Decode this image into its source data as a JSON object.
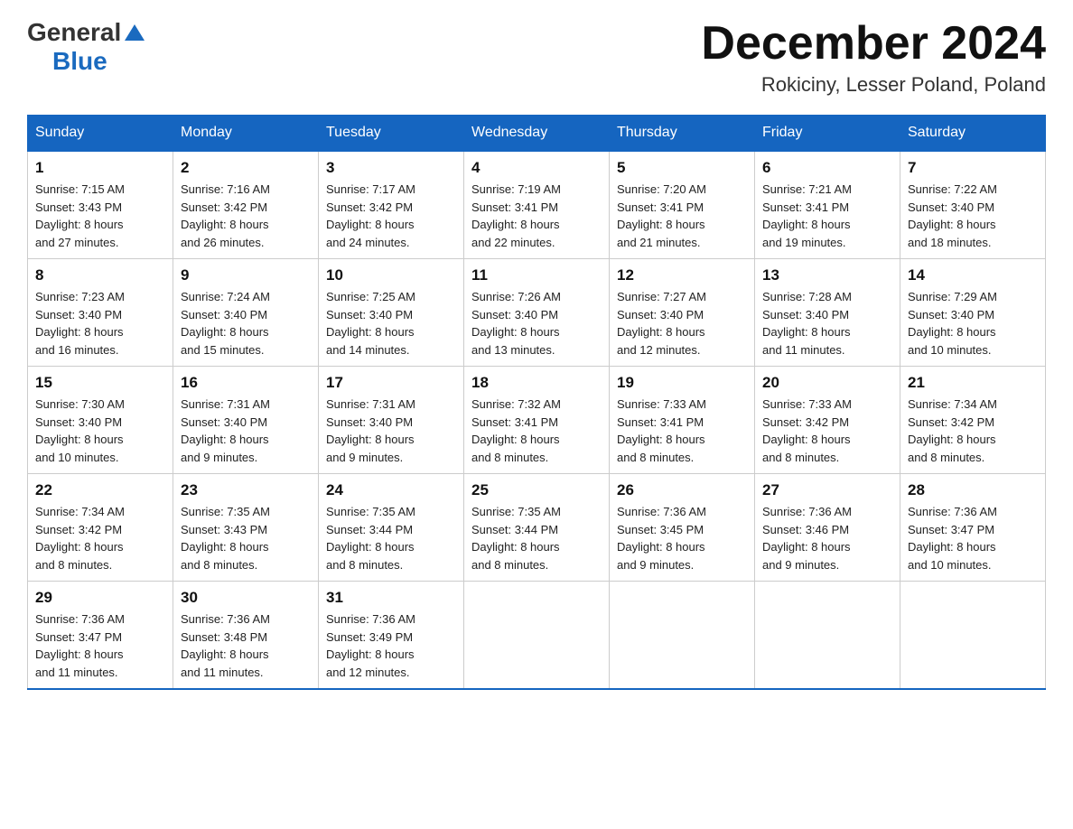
{
  "header": {
    "month_title": "December 2024",
    "location": "Rokiciny, Lesser Poland, Poland",
    "logo_general": "General",
    "logo_blue": "Blue"
  },
  "days_of_week": [
    "Sunday",
    "Monday",
    "Tuesday",
    "Wednesday",
    "Thursday",
    "Friday",
    "Saturday"
  ],
  "weeks": [
    [
      {
        "day": "1",
        "sunrise": "7:15 AM",
        "sunset": "3:43 PM",
        "daylight": "8 hours and 27 minutes."
      },
      {
        "day": "2",
        "sunrise": "7:16 AM",
        "sunset": "3:42 PM",
        "daylight": "8 hours and 26 minutes."
      },
      {
        "day": "3",
        "sunrise": "7:17 AM",
        "sunset": "3:42 PM",
        "daylight": "8 hours and 24 minutes."
      },
      {
        "day": "4",
        "sunrise": "7:19 AM",
        "sunset": "3:41 PM",
        "daylight": "8 hours and 22 minutes."
      },
      {
        "day": "5",
        "sunrise": "7:20 AM",
        "sunset": "3:41 PM",
        "daylight": "8 hours and 21 minutes."
      },
      {
        "day": "6",
        "sunrise": "7:21 AM",
        "sunset": "3:41 PM",
        "daylight": "8 hours and 19 minutes."
      },
      {
        "day": "7",
        "sunrise": "7:22 AM",
        "sunset": "3:40 PM",
        "daylight": "8 hours and 18 minutes."
      }
    ],
    [
      {
        "day": "8",
        "sunrise": "7:23 AM",
        "sunset": "3:40 PM",
        "daylight": "8 hours and 16 minutes."
      },
      {
        "day": "9",
        "sunrise": "7:24 AM",
        "sunset": "3:40 PM",
        "daylight": "8 hours and 15 minutes."
      },
      {
        "day": "10",
        "sunrise": "7:25 AM",
        "sunset": "3:40 PM",
        "daylight": "8 hours and 14 minutes."
      },
      {
        "day": "11",
        "sunrise": "7:26 AM",
        "sunset": "3:40 PM",
        "daylight": "8 hours and 13 minutes."
      },
      {
        "day": "12",
        "sunrise": "7:27 AM",
        "sunset": "3:40 PM",
        "daylight": "8 hours and 12 minutes."
      },
      {
        "day": "13",
        "sunrise": "7:28 AM",
        "sunset": "3:40 PM",
        "daylight": "8 hours and 11 minutes."
      },
      {
        "day": "14",
        "sunrise": "7:29 AM",
        "sunset": "3:40 PM",
        "daylight": "8 hours and 10 minutes."
      }
    ],
    [
      {
        "day": "15",
        "sunrise": "7:30 AM",
        "sunset": "3:40 PM",
        "daylight": "8 hours and 10 minutes."
      },
      {
        "day": "16",
        "sunrise": "7:31 AM",
        "sunset": "3:40 PM",
        "daylight": "8 hours and 9 minutes."
      },
      {
        "day": "17",
        "sunrise": "7:31 AM",
        "sunset": "3:40 PM",
        "daylight": "8 hours and 9 minutes."
      },
      {
        "day": "18",
        "sunrise": "7:32 AM",
        "sunset": "3:41 PM",
        "daylight": "8 hours and 8 minutes."
      },
      {
        "day": "19",
        "sunrise": "7:33 AM",
        "sunset": "3:41 PM",
        "daylight": "8 hours and 8 minutes."
      },
      {
        "day": "20",
        "sunrise": "7:33 AM",
        "sunset": "3:42 PM",
        "daylight": "8 hours and 8 minutes."
      },
      {
        "day": "21",
        "sunrise": "7:34 AM",
        "sunset": "3:42 PM",
        "daylight": "8 hours and 8 minutes."
      }
    ],
    [
      {
        "day": "22",
        "sunrise": "7:34 AM",
        "sunset": "3:42 PM",
        "daylight": "8 hours and 8 minutes."
      },
      {
        "day": "23",
        "sunrise": "7:35 AM",
        "sunset": "3:43 PM",
        "daylight": "8 hours and 8 minutes."
      },
      {
        "day": "24",
        "sunrise": "7:35 AM",
        "sunset": "3:44 PM",
        "daylight": "8 hours and 8 minutes."
      },
      {
        "day": "25",
        "sunrise": "7:35 AM",
        "sunset": "3:44 PM",
        "daylight": "8 hours and 8 minutes."
      },
      {
        "day": "26",
        "sunrise": "7:36 AM",
        "sunset": "3:45 PM",
        "daylight": "8 hours and 9 minutes."
      },
      {
        "day": "27",
        "sunrise": "7:36 AM",
        "sunset": "3:46 PM",
        "daylight": "8 hours and 9 minutes."
      },
      {
        "day": "28",
        "sunrise": "7:36 AM",
        "sunset": "3:47 PM",
        "daylight": "8 hours and 10 minutes."
      }
    ],
    [
      {
        "day": "29",
        "sunrise": "7:36 AM",
        "sunset": "3:47 PM",
        "daylight": "8 hours and 11 minutes."
      },
      {
        "day": "30",
        "sunrise": "7:36 AM",
        "sunset": "3:48 PM",
        "daylight": "8 hours and 11 minutes."
      },
      {
        "day": "31",
        "sunrise": "7:36 AM",
        "sunset": "3:49 PM",
        "daylight": "8 hours and 12 minutes."
      },
      null,
      null,
      null,
      null
    ]
  ],
  "labels": {
    "sunrise": "Sunrise:",
    "sunset": "Sunset:",
    "daylight": "Daylight:"
  }
}
